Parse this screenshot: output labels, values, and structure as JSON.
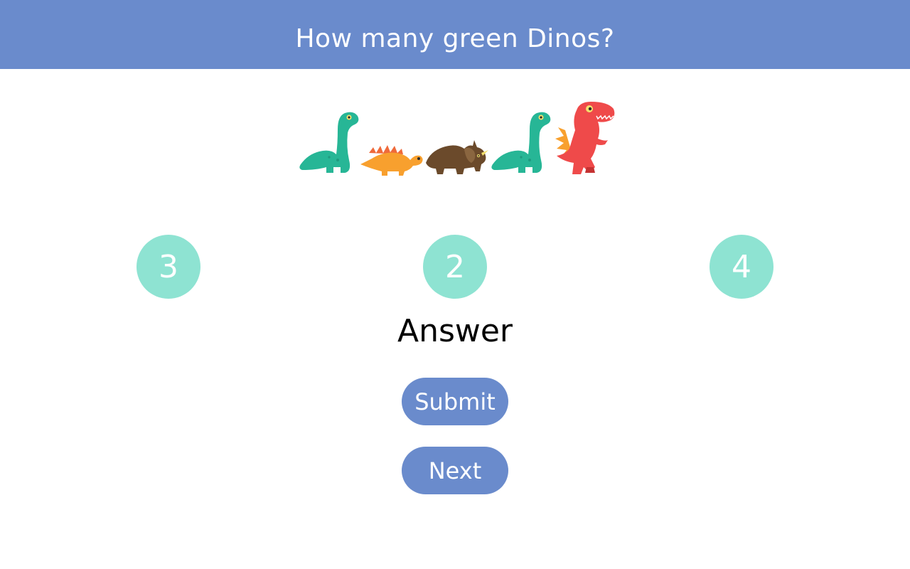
{
  "question": {
    "title": "How many green Dinos?"
  },
  "dinos": [
    {
      "kind": "long-neck",
      "color": "#27b696"
    },
    {
      "kind": "stegosaurus",
      "color": "#f8a02e"
    },
    {
      "kind": "triceratops",
      "color": "#6b4a2b"
    },
    {
      "kind": "long-neck",
      "color": "#27b696"
    },
    {
      "kind": "t-rex",
      "color": "#ef4a4a"
    }
  ],
  "choices": [
    {
      "label": "3"
    },
    {
      "label": "2"
    },
    {
      "label": "4"
    }
  ],
  "answer": {
    "label": "Answer"
  },
  "buttons": {
    "submit_label": "Submit",
    "next_label": "Next"
  },
  "colors": {
    "header": "#6a8bcc",
    "choice_circle": "#8ee3d2",
    "button": "#6a8bcc"
  }
}
